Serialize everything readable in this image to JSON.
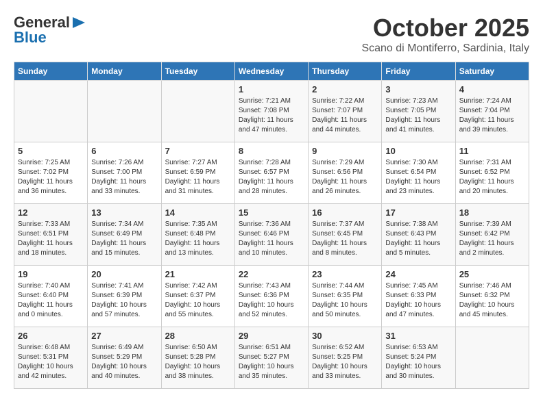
{
  "header": {
    "logo_general": "General",
    "logo_blue": "Blue",
    "month": "October 2025",
    "location": "Scano di Montiferro, Sardinia, Italy"
  },
  "columns": [
    "Sunday",
    "Monday",
    "Tuesday",
    "Wednesday",
    "Thursday",
    "Friday",
    "Saturday"
  ],
  "weeks": [
    [
      {
        "day": "",
        "info": ""
      },
      {
        "day": "",
        "info": ""
      },
      {
        "day": "",
        "info": ""
      },
      {
        "day": "1",
        "info": "Sunrise: 7:21 AM\nSunset: 7:08 PM\nDaylight: 11 hours\nand 47 minutes."
      },
      {
        "day": "2",
        "info": "Sunrise: 7:22 AM\nSunset: 7:07 PM\nDaylight: 11 hours\nand 44 minutes."
      },
      {
        "day": "3",
        "info": "Sunrise: 7:23 AM\nSunset: 7:05 PM\nDaylight: 11 hours\nand 41 minutes."
      },
      {
        "day": "4",
        "info": "Sunrise: 7:24 AM\nSunset: 7:04 PM\nDaylight: 11 hours\nand 39 minutes."
      }
    ],
    [
      {
        "day": "5",
        "info": "Sunrise: 7:25 AM\nSunset: 7:02 PM\nDaylight: 11 hours\nand 36 minutes."
      },
      {
        "day": "6",
        "info": "Sunrise: 7:26 AM\nSunset: 7:00 PM\nDaylight: 11 hours\nand 33 minutes."
      },
      {
        "day": "7",
        "info": "Sunrise: 7:27 AM\nSunset: 6:59 PM\nDaylight: 11 hours\nand 31 minutes."
      },
      {
        "day": "8",
        "info": "Sunrise: 7:28 AM\nSunset: 6:57 PM\nDaylight: 11 hours\nand 28 minutes."
      },
      {
        "day": "9",
        "info": "Sunrise: 7:29 AM\nSunset: 6:56 PM\nDaylight: 11 hours\nand 26 minutes."
      },
      {
        "day": "10",
        "info": "Sunrise: 7:30 AM\nSunset: 6:54 PM\nDaylight: 11 hours\nand 23 minutes."
      },
      {
        "day": "11",
        "info": "Sunrise: 7:31 AM\nSunset: 6:52 PM\nDaylight: 11 hours\nand 20 minutes."
      }
    ],
    [
      {
        "day": "12",
        "info": "Sunrise: 7:33 AM\nSunset: 6:51 PM\nDaylight: 11 hours\nand 18 minutes."
      },
      {
        "day": "13",
        "info": "Sunrise: 7:34 AM\nSunset: 6:49 PM\nDaylight: 11 hours\nand 15 minutes."
      },
      {
        "day": "14",
        "info": "Sunrise: 7:35 AM\nSunset: 6:48 PM\nDaylight: 11 hours\nand 13 minutes."
      },
      {
        "day": "15",
        "info": "Sunrise: 7:36 AM\nSunset: 6:46 PM\nDaylight: 11 hours\nand 10 minutes."
      },
      {
        "day": "16",
        "info": "Sunrise: 7:37 AM\nSunset: 6:45 PM\nDaylight: 11 hours\nand 8 minutes."
      },
      {
        "day": "17",
        "info": "Sunrise: 7:38 AM\nSunset: 6:43 PM\nDaylight: 11 hours\nand 5 minutes."
      },
      {
        "day": "18",
        "info": "Sunrise: 7:39 AM\nSunset: 6:42 PM\nDaylight: 11 hours\nand 2 minutes."
      }
    ],
    [
      {
        "day": "19",
        "info": "Sunrise: 7:40 AM\nSunset: 6:40 PM\nDaylight: 11 hours\nand 0 minutes."
      },
      {
        "day": "20",
        "info": "Sunrise: 7:41 AM\nSunset: 6:39 PM\nDaylight: 10 hours\nand 57 minutes."
      },
      {
        "day": "21",
        "info": "Sunrise: 7:42 AM\nSunset: 6:37 PM\nDaylight: 10 hours\nand 55 minutes."
      },
      {
        "day": "22",
        "info": "Sunrise: 7:43 AM\nSunset: 6:36 PM\nDaylight: 10 hours\nand 52 minutes."
      },
      {
        "day": "23",
        "info": "Sunrise: 7:44 AM\nSunset: 6:35 PM\nDaylight: 10 hours\nand 50 minutes."
      },
      {
        "day": "24",
        "info": "Sunrise: 7:45 AM\nSunset: 6:33 PM\nDaylight: 10 hours\nand 47 minutes."
      },
      {
        "day": "25",
        "info": "Sunrise: 7:46 AM\nSunset: 6:32 PM\nDaylight: 10 hours\nand 45 minutes."
      }
    ],
    [
      {
        "day": "26",
        "info": "Sunrise: 6:48 AM\nSunset: 5:31 PM\nDaylight: 10 hours\nand 42 minutes."
      },
      {
        "day": "27",
        "info": "Sunrise: 6:49 AM\nSunset: 5:29 PM\nDaylight: 10 hours\nand 40 minutes."
      },
      {
        "day": "28",
        "info": "Sunrise: 6:50 AM\nSunset: 5:28 PM\nDaylight: 10 hours\nand 38 minutes."
      },
      {
        "day": "29",
        "info": "Sunrise: 6:51 AM\nSunset: 5:27 PM\nDaylight: 10 hours\nand 35 minutes."
      },
      {
        "day": "30",
        "info": "Sunrise: 6:52 AM\nSunset: 5:25 PM\nDaylight: 10 hours\nand 33 minutes."
      },
      {
        "day": "31",
        "info": "Sunrise: 6:53 AM\nSunset: 5:24 PM\nDaylight: 10 hours\nand 30 minutes."
      },
      {
        "day": "",
        "info": ""
      }
    ]
  ]
}
